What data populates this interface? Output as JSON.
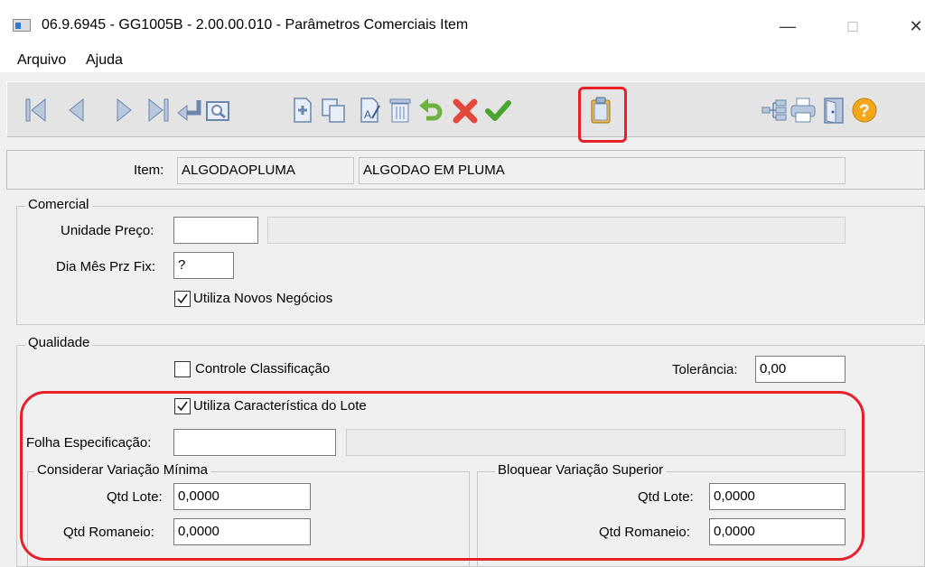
{
  "window": {
    "title": "06.9.6945 - GG1005B - 2.00.00.010 - Parâmetros Comerciais Item",
    "minimize": "—",
    "maximize": "□",
    "close": "✕"
  },
  "menu": {
    "file": "Arquivo",
    "help": "Ajuda"
  },
  "toolbar": {
    "icons": [
      "first-record-icon",
      "previous-record-icon",
      "next-record-icon",
      "last-record-icon",
      "go-to-icon",
      "search-icon",
      "new-record-icon",
      "copy-icon",
      "edit-icon",
      "delete-icon",
      "undo-icon",
      "cancel-icon",
      "confirm-icon",
      "clipboard-icon",
      "tree-icon",
      "print-icon",
      "exit-icon",
      "help-icon"
    ],
    "highlight_color": "#e8202a"
  },
  "item": {
    "label": "Item:",
    "code": "ALGODAOPLUMA",
    "description": "ALGODAO EM PLUMA"
  },
  "comercial": {
    "title": "Comercial",
    "unidade_preco_label": "Unidade Preço:",
    "unidade_preco": "",
    "unidade_preco_desc": "",
    "dia_mes_label": "Dia Mês Prz Fix:",
    "dia_mes_value": "?",
    "novos_negocios_label": "Utiliza Novos Negócios",
    "novos_negocios_checked": true
  },
  "qualidade": {
    "title": "Qualidade",
    "controle_label": "Controle Classificação",
    "controle_checked": false,
    "tolerancia_label": "Tolerância:",
    "tolerancia_value": "0,00",
    "caracteristica_label": "Utiliza Característica do Lote",
    "caracteristica_checked": true,
    "folha_label": "Folha Especificação:",
    "folha_value": "",
    "folha_desc": "",
    "minima": {
      "title": "Considerar Variação Mínima",
      "qtd_lote_label": "Qtd Lote:",
      "qtd_lote_value": "0,0000",
      "qtd_romaneio_label": "Qtd Romaneio:",
      "qtd_romaneio_value": "0,0000"
    },
    "superior": {
      "title": "Bloquear Variação Superior",
      "qtd_lote_label": "Qtd Lote:",
      "qtd_lote_value": "0,0000",
      "qtd_romaneio_label": "Qtd Romaneio:",
      "qtd_romaneio_value": "0,0000"
    }
  }
}
